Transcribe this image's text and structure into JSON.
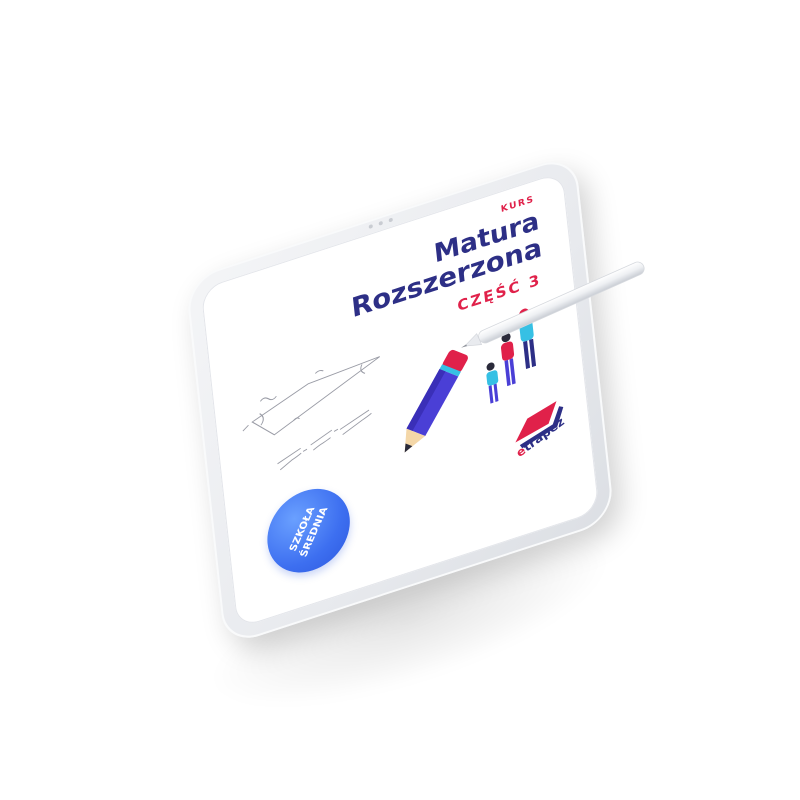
{
  "cover": {
    "kurs": "KURS",
    "title_line1": "Matura",
    "title_line2": "Rozszerzona",
    "part": "CZĘŚĆ 3",
    "badge_line1": "SZKOŁA",
    "badge_line2": "ŚREDNIA"
  },
  "logo": {
    "text_e": "e",
    "text_rest": "trapez"
  },
  "icons": {
    "stylus": "stylus-icon",
    "pencil": "pencil-icon",
    "people": "people-illustration",
    "math": "math-sketch"
  },
  "colors": {
    "title": "#2d2f86",
    "accent_red": "#e0214a",
    "badge_blue": "#3d6ff0"
  }
}
